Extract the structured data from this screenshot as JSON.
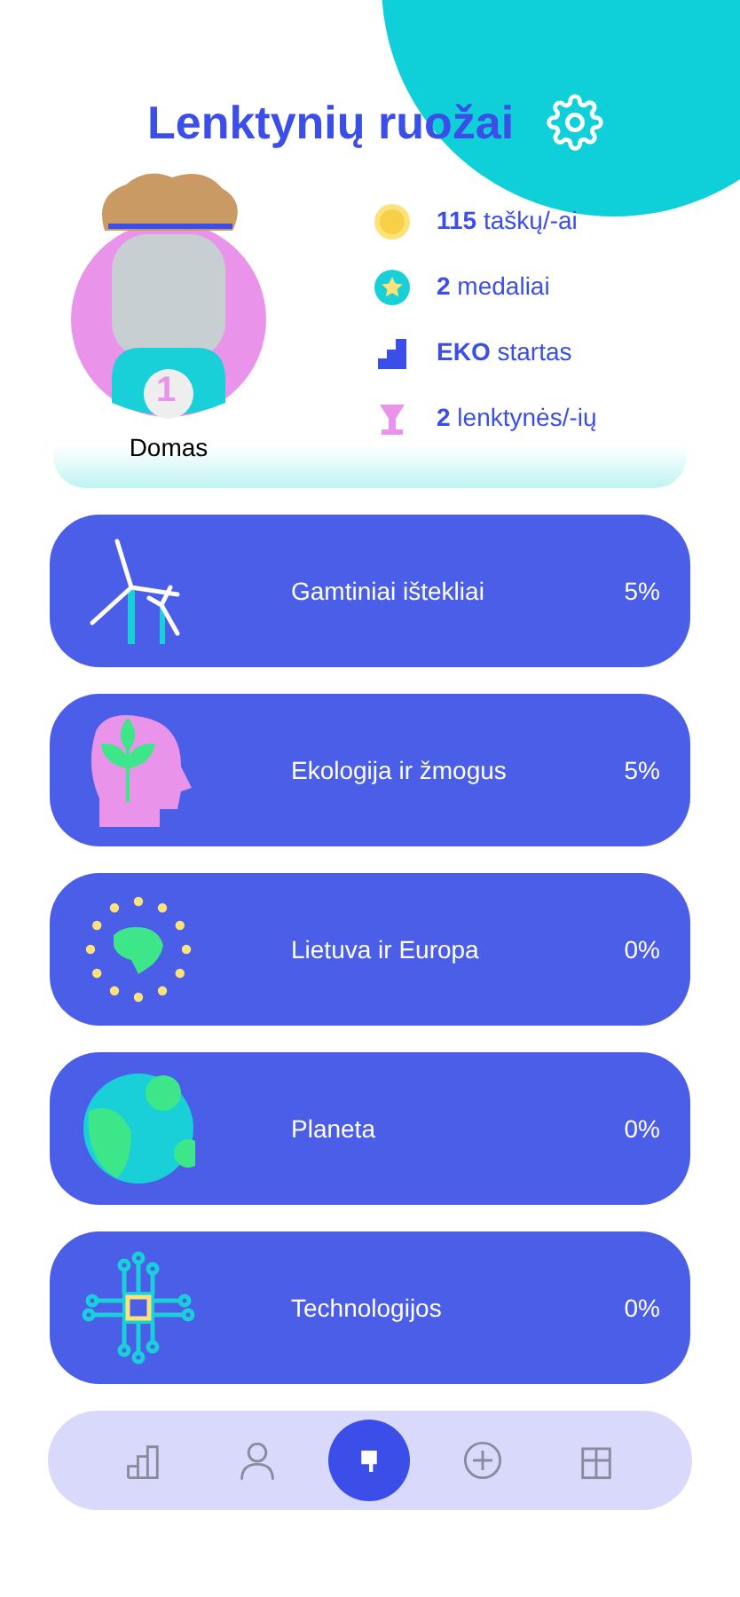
{
  "header": {
    "title": "Lenktynių ruožai"
  },
  "profile": {
    "name": "Domas",
    "badge_number": "1"
  },
  "stats": [
    {
      "kind": "coin",
      "text": "**115** taškų/-ai"
    },
    {
      "kind": "medal",
      "text": "**2** medaliai"
    },
    {
      "kind": "stairs",
      "text": "**EKO** startas"
    },
    {
      "kind": "cup",
      "text": "**2** lenktynės/-ių"
    }
  ],
  "categories": [
    {
      "kind": "wind",
      "label": "Gamtiniai ištekliai",
      "percent": "5%"
    },
    {
      "kind": "head",
      "label": "Ekologija ir žmogus",
      "percent": "5%"
    },
    {
      "kind": "europe",
      "label": "Lietuva ir Europa",
      "percent": "0%"
    },
    {
      "kind": "planet",
      "label": "Planeta",
      "percent": "0%"
    },
    {
      "kind": "chip",
      "label": "Technologijos",
      "percent": "0%"
    }
  ],
  "nav": [
    {
      "kind": "chart",
      "selected": false
    },
    {
      "kind": "person",
      "selected": false
    },
    {
      "kind": "flag",
      "selected": true
    },
    {
      "kind": "plus",
      "selected": false
    },
    {
      "kind": "gift",
      "selected": false
    }
  ]
}
